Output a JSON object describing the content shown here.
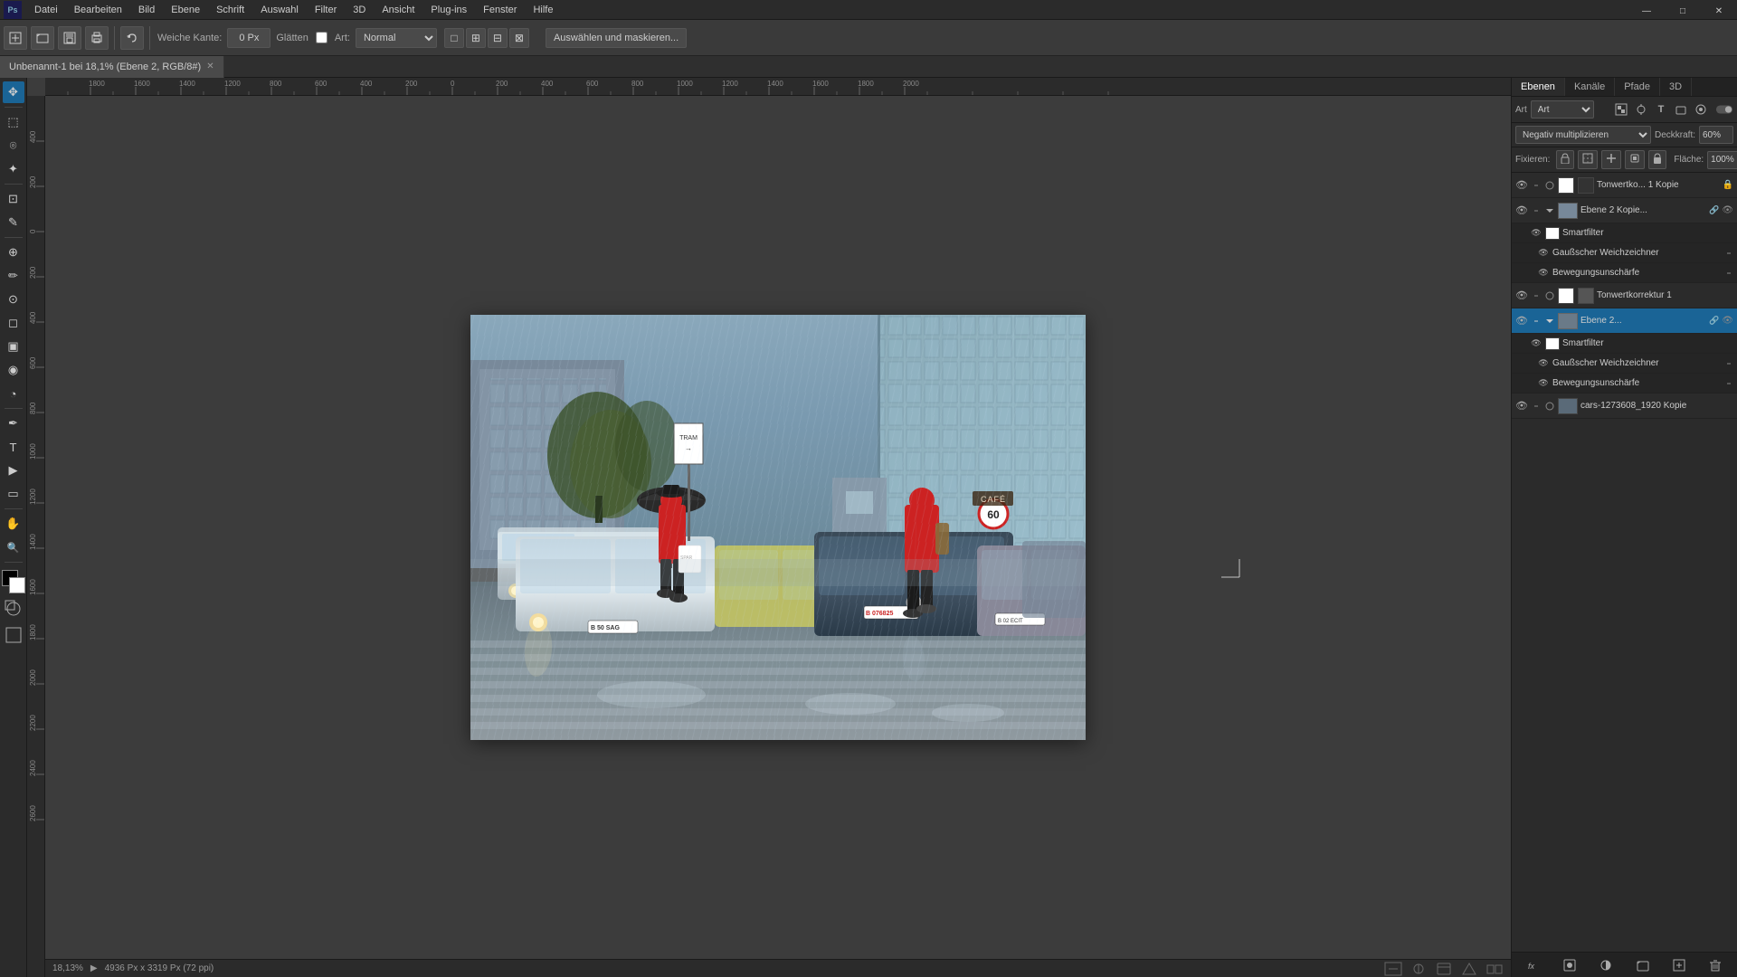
{
  "app": {
    "title": "Adobe Photoshop",
    "window_controls": {
      "minimize": "—",
      "maximize": "□",
      "close": "✕"
    }
  },
  "menu": {
    "items": [
      "Datei",
      "Bearbeiten",
      "Bild",
      "Ebene",
      "Schrift",
      "Auswahl",
      "Filter",
      "3D",
      "Ansicht",
      "Plug-ins",
      "Fenster",
      "Hilfe"
    ]
  },
  "toolbar": {
    "soft_edge_label": "Weiche Kante:",
    "soft_edge_value": "0 Px",
    "glatt_label": "Glätten",
    "art_label": "Art:",
    "art_mode": "Normal",
    "select_mask_btn": "Auswählen und maskieren..."
  },
  "tab": {
    "title": "Unbenannt-1 bei 18,1% (Ebene 2, RGB/8#)",
    "close": "✕"
  },
  "canvas": {
    "zoom_level": "18,13%",
    "image_info": "4936 Px x 3319 Px (72 ppi)",
    "status_extra": ""
  },
  "tools": {
    "list": [
      {
        "name": "move",
        "icon": "✥"
      },
      {
        "name": "rectangle-select",
        "icon": "⬚"
      },
      {
        "name": "lasso",
        "icon": "⌾"
      },
      {
        "name": "magic-wand",
        "icon": "✦"
      },
      {
        "name": "crop",
        "icon": "⊡"
      },
      {
        "name": "eyedropper",
        "icon": "✎"
      },
      {
        "name": "healing",
        "icon": "⊕"
      },
      {
        "name": "brush",
        "icon": "✏"
      },
      {
        "name": "clone-stamp",
        "icon": "⊙"
      },
      {
        "name": "eraser",
        "icon": "◻"
      },
      {
        "name": "gradient",
        "icon": "▣"
      },
      {
        "name": "blur",
        "icon": "◉"
      },
      {
        "name": "dodge",
        "icon": "◔"
      },
      {
        "name": "pen",
        "icon": "✒"
      },
      {
        "name": "type",
        "icon": "T"
      },
      {
        "name": "path-select",
        "icon": "▶"
      },
      {
        "name": "shape",
        "icon": "▭"
      },
      {
        "name": "hand",
        "icon": "✋"
      },
      {
        "name": "zoom",
        "icon": "🔍"
      }
    ]
  },
  "layers_panel": {
    "tabs": [
      "Ebenen",
      "Kanäle",
      "Pfade",
      "3D"
    ],
    "active_tab": "Ebenen",
    "filter_label": "Art",
    "blend_mode": "Negativ multiplizieren",
    "opacity_label": "Deckkraft:",
    "opacity_value": "60%",
    "lock_label": "Fixieren:",
    "fill_label": "Fläche:",
    "fill_value": "100%",
    "layers": [
      {
        "id": "tonwert-kopie",
        "name": "Tonwertko... 1 Kopie",
        "visible": true,
        "type": "adjustment",
        "thumb": "white",
        "locked": false,
        "has_mask": true
      },
      {
        "id": "ebene2-kopie",
        "name": "Ebene 2 Kopie...",
        "visible": true,
        "type": "group",
        "thumb": "photo",
        "locked": false,
        "expanded": true,
        "sublayers": [
          {
            "id": "smartfilter1",
            "name": "Smartfilter",
            "visible": true,
            "type": "filter",
            "thumb": "white"
          },
          {
            "id": "gauss1",
            "name": "Gaußscher Weichzeichner",
            "visible": true,
            "type": "sub"
          },
          {
            "id": "bewegungs1",
            "name": "Bewegungsunschärfe",
            "visible": true,
            "type": "sub"
          }
        ]
      },
      {
        "id": "tonwert1",
        "name": "Tonwertkorrektur 1",
        "visible": true,
        "type": "adjustment",
        "thumb": "white",
        "locked": false
      },
      {
        "id": "ebene2",
        "name": "Ebene 2...",
        "visible": true,
        "type": "group",
        "thumb": "photo",
        "locked": false,
        "active": true,
        "expanded": true,
        "sublayers": [
          {
            "id": "smartfilter2",
            "name": "Smartfilter",
            "visible": true,
            "type": "filter",
            "thumb": "white"
          },
          {
            "id": "gauss2",
            "name": "Gaußscher Weichzeichner",
            "visible": true,
            "type": "sub"
          },
          {
            "id": "bewegungs2",
            "name": "Bewegungsunschärfe",
            "visible": true,
            "type": "sub"
          }
        ]
      },
      {
        "id": "cars-kopie",
        "name": "cars-1273608_1920 Kopie",
        "visible": true,
        "type": "normal",
        "thumb": "photo",
        "locked": false
      }
    ],
    "bottom_buttons": [
      "fx",
      "mask",
      "adjustment",
      "group",
      "new",
      "trash"
    ]
  }
}
